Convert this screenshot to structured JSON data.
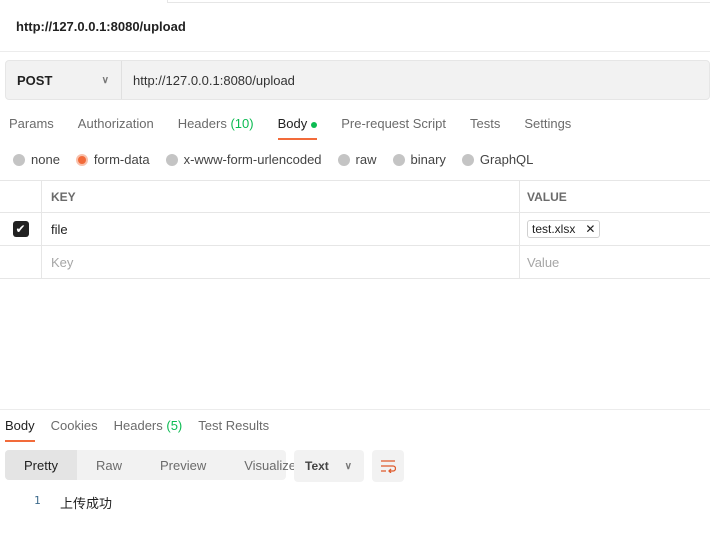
{
  "request_title": "http://127.0.0.1:8080/upload",
  "method": "POST",
  "url": "http://127.0.0.1:8080/upload",
  "tabs": {
    "params": "Params",
    "authorization": "Authorization",
    "headers": "Headers",
    "headers_count": "(10)",
    "body": "Body",
    "prerequest": "Pre-request Script",
    "tests": "Tests",
    "settings": "Settings"
  },
  "body_types": [
    "none",
    "form-data",
    "x-www-form-urlencoded",
    "raw",
    "binary",
    "GraphQL"
  ],
  "table": {
    "key_header": "KEY",
    "value_header": "VALUE",
    "rows": [
      {
        "key": "file",
        "value": "test.xlsx",
        "checked": true
      }
    ],
    "key_placeholder": "Key",
    "value_placeholder": "Value"
  },
  "response_tabs": {
    "body": "Body",
    "cookies": "Cookies",
    "headers": "Headers",
    "headers_count": "(5)",
    "test_results": "Test Results"
  },
  "view_modes": [
    "Pretty",
    "Raw",
    "Preview",
    "Visualize"
  ],
  "format": "Text",
  "response": {
    "line": "1",
    "text": "上传成功"
  },
  "accent": "#f26b3a"
}
